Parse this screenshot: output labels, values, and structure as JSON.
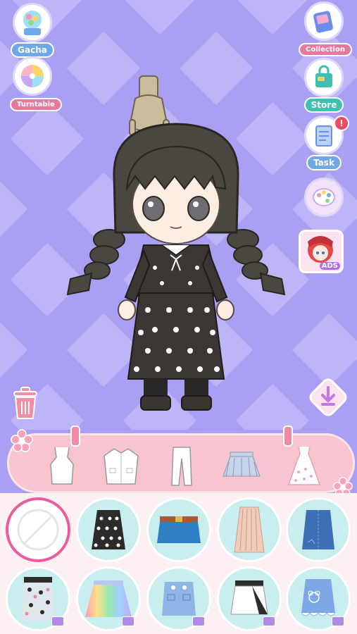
{
  "left_buttons": [
    {
      "label": "Gacha",
      "icon": "gacha-icon"
    },
    {
      "label": "Turntable",
      "icon": "turntable-icon"
    }
  ],
  "right_buttons": [
    {
      "label": "Collection",
      "icon": "collection-icon"
    },
    {
      "label": "Store",
      "icon": "store-icon"
    },
    {
      "label": "Task",
      "icon": "task-icon",
      "badge": "!"
    },
    {
      "icon": "palette-icon"
    },
    {
      "icon": "ads-icon",
      "ads_label": "ADS"
    }
  ],
  "tool_icons": [
    "trash-icon",
    "download-icon"
  ],
  "category_tabs": [
    "camisole-top-icon",
    "jacket-icon",
    "pants-icon",
    "skirt-icon",
    "dress-icon"
  ],
  "items": [
    {
      "icon": "none-icon",
      "selected": true
    },
    {
      "icon": "polka-dot-skirt-icon"
    },
    {
      "icon": "blue-mini-skirt-icon"
    },
    {
      "icon": "beige-pleated-skirt-icon"
    },
    {
      "icon": "denim-skirt-icon"
    },
    {
      "icon": "leopard-skirt-icon",
      "video": true
    },
    {
      "icon": "rainbow-skirt-icon",
      "video": true
    },
    {
      "icon": "light-denim-skirt-icon",
      "video": true
    },
    {
      "icon": "white-skort-icon",
      "video": true
    },
    {
      "icon": "bear-denim-skirt-icon",
      "video": true
    }
  ],
  "colors": {
    "background": "#a99ff3",
    "tabbar": "#f7c4cf",
    "item_bg": "#c9eef0",
    "selected_ring": "#ec5b9c"
  }
}
